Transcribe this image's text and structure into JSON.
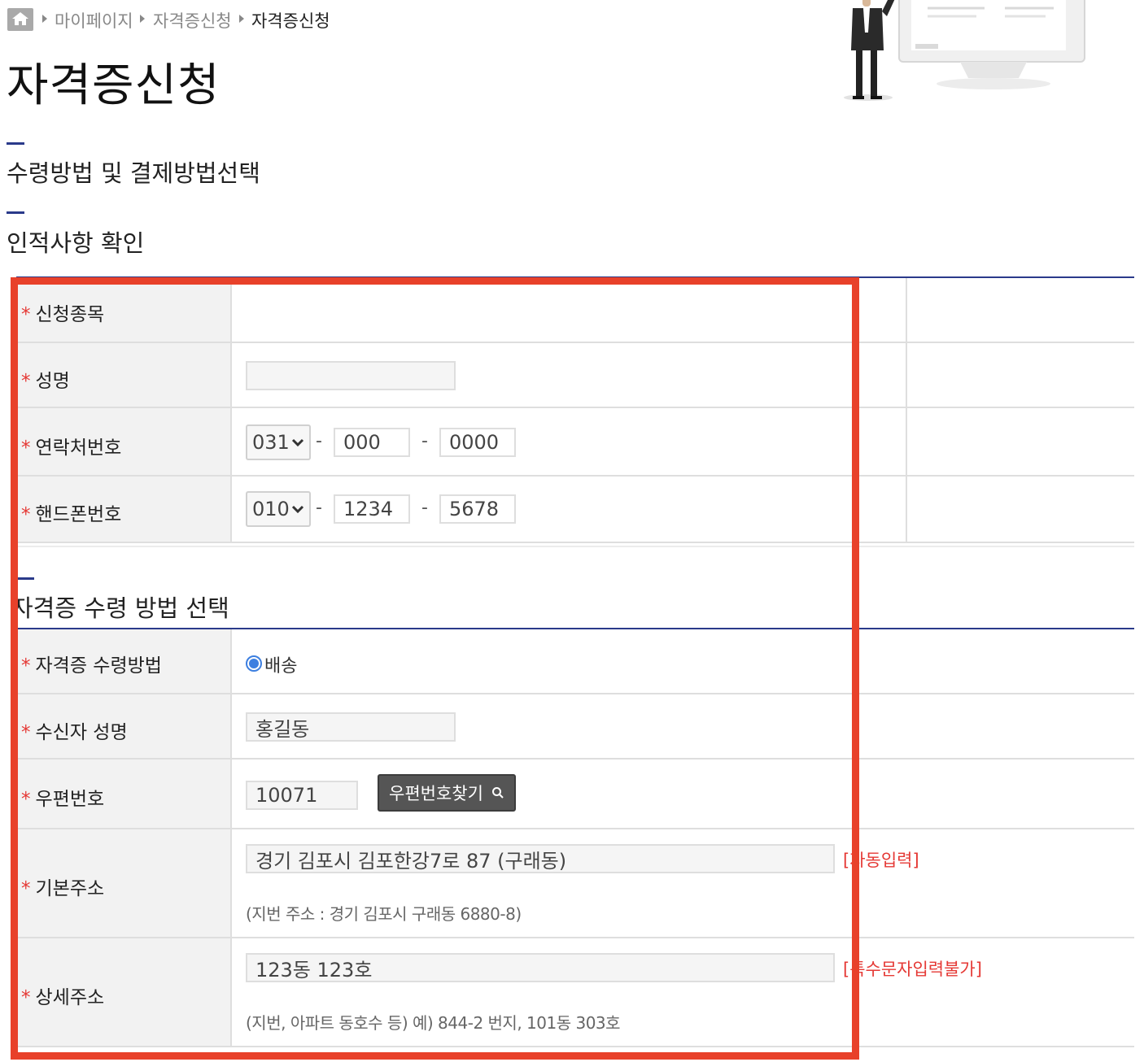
{
  "breadcrumb": {
    "home_icon": "home-icon",
    "items": [
      "마이페이지",
      "자격증신청",
      "자격증신청"
    ]
  },
  "page": {
    "title": "자격증신청"
  },
  "sections": {
    "receipt_payment": "수령방법 및 결제방법선택",
    "personal_info": "인적사항 확인",
    "receipt_method": "자격증 수령 방법 선택"
  },
  "personal_info": {
    "required_mark": "*",
    "rows": {
      "subject": {
        "label": "신청종목",
        "value": ""
      },
      "name": {
        "label": "성명",
        "value": ""
      },
      "phone": {
        "label": "연락처번호",
        "area_code": "031",
        "middle": "000",
        "last": "0000"
      },
      "mobile": {
        "label": "핸드폰번호",
        "prefix": "010",
        "middle": "1234",
        "last": "5678"
      }
    },
    "separator": "-"
  },
  "receipt": {
    "method": {
      "label": "자격증 수령방법",
      "option": "배송",
      "selected": true
    },
    "recipient": {
      "label": "수신자 성명",
      "value": "홍길동"
    },
    "postal": {
      "label": "우편번호",
      "value": "10071",
      "button": "우편번호찾기",
      "button_icon": "search-icon"
    },
    "address": {
      "label": "기본주소",
      "value": "경기 김포시 김포한강7로 87 (구래동)",
      "note": "[자동입력]",
      "hint": "(지번 주소 : 경기 김포시 구래동 6880-8)"
    },
    "detail": {
      "label": "상세주소",
      "value": "123동 123호",
      "note": "[특수문자입력불가]",
      "hint": "(지번, 아파트 동호수 등) 예) 844-2 번지, 101동 303호"
    }
  },
  "colors": {
    "accent_navy": "#2a3a8a",
    "required_red": "#e53935",
    "highlight_red": "#e8412a",
    "radio_blue": "#3d7fe0"
  }
}
